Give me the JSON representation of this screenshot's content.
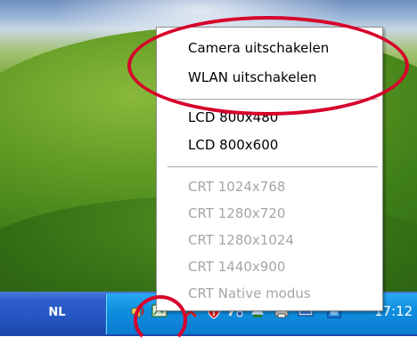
{
  "context_menu": {
    "items": [
      {
        "label": "Camera uitschakelen",
        "enabled": true
      },
      {
        "label": "WLAN uitschakelen",
        "enabled": true
      },
      {
        "label": "LCD 800x480",
        "enabled": true
      },
      {
        "label": "LCD 800x600",
        "enabled": true
      },
      {
        "label": "CRT 1024x768",
        "enabled": false
      },
      {
        "label": "CRT 1280x720",
        "enabled": false
      },
      {
        "label": "CRT 1280x1024",
        "enabled": false
      },
      {
        "label": "CRT 1440x900",
        "enabled": false
      },
      {
        "label": "CRT Native modus",
        "enabled": false
      }
    ]
  },
  "taskbar": {
    "language": "NL",
    "clock": "17:12",
    "tray_icons": [
      "speaker-icon",
      "display-settings-icon",
      "security-alert-icon",
      "shield-icon",
      "network-icon",
      "safely-remove-icon",
      "monitor-icon",
      "app-icon"
    ]
  },
  "colors": {
    "annotation": "#d6002a",
    "taskbar_blue": "#2555c1",
    "tray_blue": "#0f8fdf",
    "disabled_text": "#a6a6a6"
  }
}
